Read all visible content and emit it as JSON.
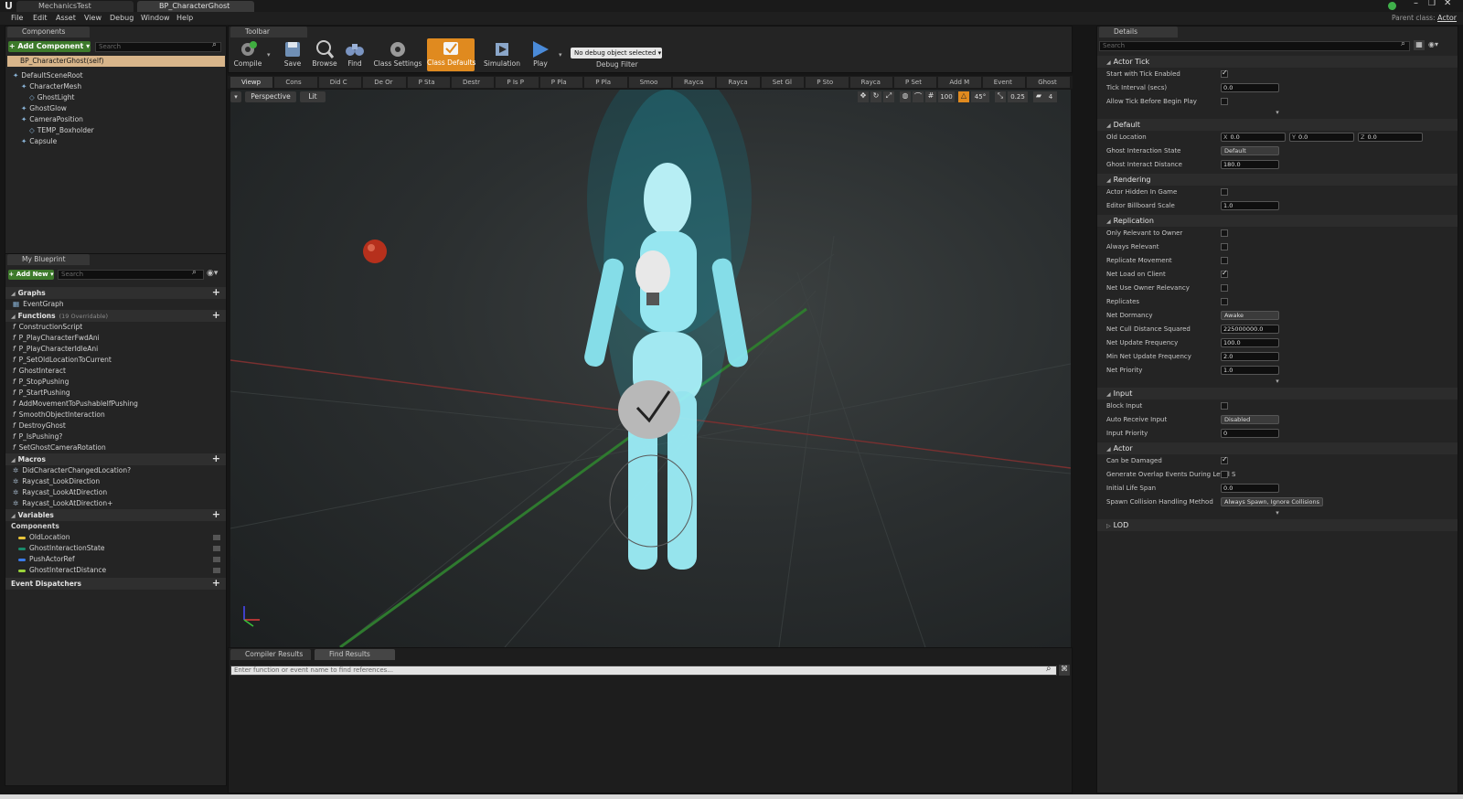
{
  "titlebar": {
    "tabs": [
      "MechanicsTest",
      "BP_CharacterGhost"
    ],
    "parent_class_label": "Parent class:",
    "parent_class_value": "Actor"
  },
  "menu": [
    "File",
    "Edit",
    "Asset",
    "View",
    "Debug",
    "Window",
    "Help"
  ],
  "components": {
    "tab": "Components",
    "add_button": "+ Add Component ▾",
    "search_placeholder": "Search",
    "self_item": "BP_CharacterGhost(self)",
    "tree": [
      {
        "label": "DefaultSceneRoot",
        "depth": 0
      },
      {
        "label": "CharacterMesh",
        "depth": 1
      },
      {
        "label": "GhostLight",
        "depth": 2
      },
      {
        "label": "GhostGlow",
        "depth": 1
      },
      {
        "label": "CameraPosition",
        "depth": 1
      },
      {
        "label": "TEMP_Boxholder",
        "depth": 2
      },
      {
        "label": "Capsule",
        "depth": 1
      }
    ]
  },
  "my_blueprint": {
    "tab": "My Blueprint",
    "add_button": "+ Add New ▾",
    "search_placeholder": "Search",
    "graphs_label": "Graphs",
    "event_graph": "EventGraph",
    "functions_label": "Functions",
    "functions_count": "(19 Overridable)",
    "functions": [
      "ConstructionScript",
      "P_PlayCharacterFwdAni",
      "P_PlayCharacterIdleAni",
      "P_SetOldLocationToCurrent",
      "GhostInteract",
      "P_StopPushing",
      "P_StartPushing",
      "AddMovementToPushableIfPushing",
      "SmoothObjectInteraction",
      "DestroyGhost",
      "P_IsPushing?",
      "SetGhostCameraRotation"
    ],
    "macros_label": "Macros",
    "macros": [
      "DidCharacterChangedLocation?",
      "Raycast_LookDirection",
      "Raycast_LookAtDirection",
      "Raycast_LookAtDirection+"
    ],
    "variables_label": "Variables",
    "components_label": "Components",
    "variables": [
      {
        "name": "OldLocation",
        "color": "#e8c43a"
      },
      {
        "name": "GhostInteractionState",
        "color": "#1a8a6a"
      },
      {
        "name": "PushActorRef",
        "color": "#3a7ae8"
      },
      {
        "name": "GhostInteractDistance",
        "color": "#9ad33a"
      }
    ],
    "event_dispatchers_label": "Event Dispatchers"
  },
  "toolbar": {
    "tab": "Toolbar",
    "buttons": [
      "Compile",
      "Save",
      "Browse",
      "Find",
      "Class Settings",
      "Class Defaults",
      "Simulation",
      "Play"
    ],
    "debug_select": "No debug object selected ▾",
    "debug_filter": "Debug Filter"
  },
  "graph_tabs": [
    "Viewp",
    "Cons",
    "Did C",
    "De Or",
    "P Sta",
    "Destr",
    "P Is P",
    "P Pla",
    "P Pla",
    "Smoo",
    "Rayca",
    "Rayca",
    "Set Gl",
    "P Sto",
    "Rayca",
    "P Set",
    "Add M",
    "Event",
    "Ghost"
  ],
  "viewport": {
    "perspective": "Perspective",
    "lit": "Lit",
    "grid_snap": "100",
    "rot_snap": "45°",
    "scale_snap": "0.25",
    "cam_speed": "4"
  },
  "bottom": {
    "tabs": [
      "Compiler Results",
      "Find Results"
    ],
    "find_placeholder": "Enter function or event name to find references..."
  },
  "details": {
    "tab": "Details",
    "search_placeholder": "Search",
    "sections": [
      {
        "title": "Actor Tick",
        "rows": [
          {
            "label": "Start with Tick Enabled",
            "type": "check",
            "value": true
          },
          {
            "label": "Tick Interval (secs)",
            "type": "input",
            "value": "0.0"
          },
          {
            "label": "Allow Tick Before Begin Play",
            "type": "check",
            "value": false
          }
        ],
        "more": true
      },
      {
        "title": "Default",
        "rows": [
          {
            "label": "Old Location",
            "type": "vec3",
            "x": "0.0",
            "y": "0.0",
            "z": "0.0"
          },
          {
            "label": "Ghost Interaction State",
            "type": "select",
            "value": "Default"
          },
          {
            "label": "Ghost Interact Distance",
            "type": "input",
            "value": "180.0"
          }
        ]
      },
      {
        "title": "Rendering",
        "rows": [
          {
            "label": "Actor Hidden In Game",
            "type": "check",
            "value": false
          },
          {
            "label": "Editor Billboard Scale",
            "type": "input",
            "value": "1.0"
          }
        ]
      },
      {
        "title": "Replication",
        "rows": [
          {
            "label": "Only Relevant to Owner",
            "type": "check",
            "value": false
          },
          {
            "label": "Always Relevant",
            "type": "check",
            "value": false
          },
          {
            "label": "Replicate Movement",
            "type": "check",
            "value": false
          },
          {
            "label": "Net Load on Client",
            "type": "check",
            "value": true
          },
          {
            "label": "Net Use Owner Relevancy",
            "type": "check",
            "value": false
          },
          {
            "label": "Replicates",
            "type": "check",
            "value": false
          },
          {
            "label": "Net Dormancy",
            "type": "select",
            "value": "Awake"
          },
          {
            "label": "Net Cull Distance Squared",
            "type": "input",
            "value": "225000000.0"
          },
          {
            "label": "Net Update Frequency",
            "type": "input",
            "value": "100.0"
          },
          {
            "label": "Min Net Update Frequency",
            "type": "input",
            "value": "2.0"
          },
          {
            "label": "Net Priority",
            "type": "input",
            "value": "1.0"
          }
        ],
        "more": true
      },
      {
        "title": "Input",
        "rows": [
          {
            "label": "Block Input",
            "type": "check",
            "value": false
          },
          {
            "label": "Auto Receive Input",
            "type": "select",
            "value": "Disabled"
          },
          {
            "label": "Input Priority",
            "type": "input",
            "value": "0"
          }
        ]
      },
      {
        "title": "Actor",
        "rows": [
          {
            "label": "Can be Damaged",
            "type": "check",
            "value": true
          },
          {
            "label": "Generate Overlap Events During Level S",
            "type": "check",
            "value": false
          },
          {
            "label": "Initial Life Span",
            "type": "input",
            "value": "0.0"
          },
          {
            "label": "Spawn Collision Handling Method",
            "type": "select",
            "value": "Always Spawn, Ignore Collisions"
          }
        ],
        "more": true
      },
      {
        "title": "LOD",
        "rows": [],
        "collapsed": true
      }
    ]
  }
}
